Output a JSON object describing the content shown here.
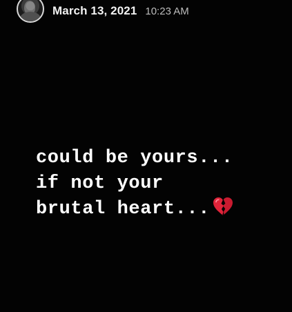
{
  "header": {
    "date": "March 13, 2021",
    "time": "10:23 AM",
    "avatar_icon": "profile-photo"
  },
  "caption": {
    "line1": "could be yours...",
    "line2": "if not your",
    "line3": "brutal heart...",
    "emoji": "broken-heart-icon"
  },
  "colors": {
    "background": "#030303",
    "text": "#ffffff",
    "heart": "#e0243a"
  }
}
